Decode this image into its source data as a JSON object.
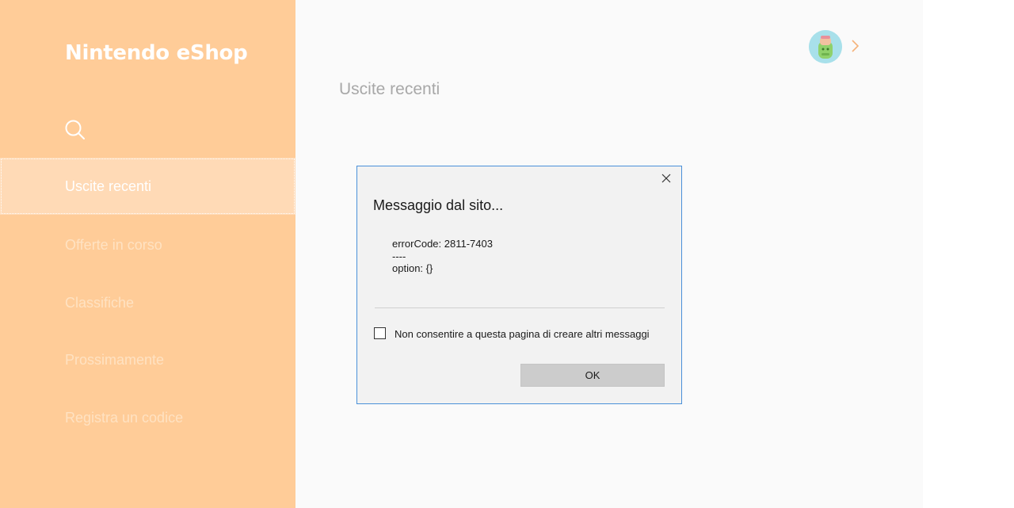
{
  "sidebar": {
    "logo": "Nintendo eShop",
    "search_icon": "search-icon",
    "items": [
      {
        "label": "Uscite recenti",
        "active": true
      },
      {
        "label": "Offerte in corso"
      },
      {
        "label": "Classifiche"
      },
      {
        "label": "Prossimamente"
      },
      {
        "label": "Registra un codice"
      }
    ]
  },
  "header": {
    "avatar_icon": "avatar-icon",
    "chevron_icon": "chevron-right-icon"
  },
  "main": {
    "title": "Uscite recenti"
  },
  "dialog": {
    "title": "Messaggio dal sito...",
    "message_lines": [
      "errorCode: 2811-7403",
      "----",
      "option: {}"
    ],
    "checkbox_label": "Non consentire a questa pagina di creare altri messaggi",
    "checkbox_checked": false,
    "ok_label": "OK",
    "close_icon": "close-icon"
  },
  "colors": {
    "sidebar_bg": "#ffcc98",
    "sidebar_active_bg": "#ffdab6",
    "main_bg": "#fafafa",
    "dialog_border": "#4a90d9",
    "chevron": "#f5b27a"
  }
}
